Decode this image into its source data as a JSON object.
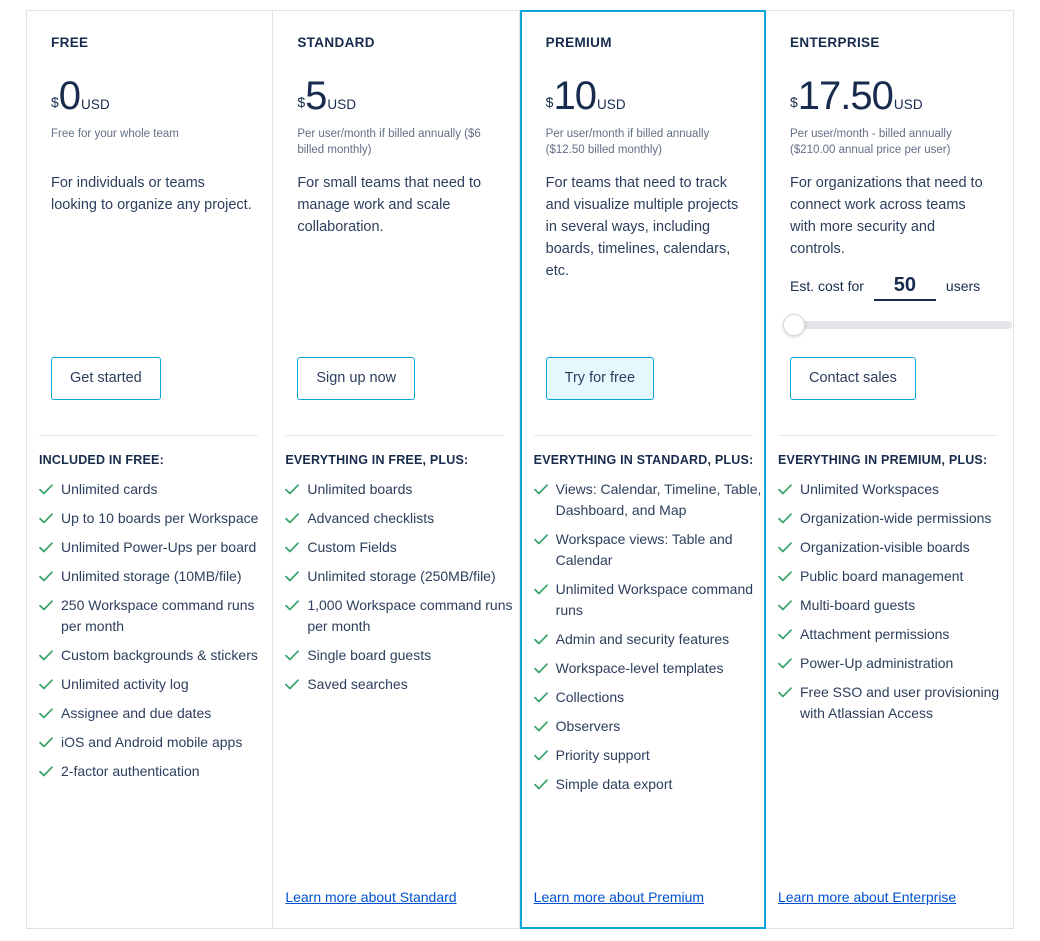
{
  "theme": {
    "accent": "#0ca5da",
    "accent_soft": "#e5f8fd",
    "text_primary": "#172b4d",
    "text_body": "#2c3e5d",
    "text_muted": "#626f86",
    "check_green": "#36a369",
    "link_blue": "#0052cc",
    "border_gray": "#dfe1e6"
  },
  "plans": [
    {
      "name": "FREE",
      "currency": "$",
      "amount": "0",
      "unit": "USD",
      "price_note": "Free for your whole team",
      "description": "For individuals or teams looking to organize any project.",
      "cta_label": "Get started",
      "cta_style": "outline",
      "features_title": "INCLUDED IN FREE:",
      "features": [
        "Unlimited cards",
        "Up to 10 boards per Workspace",
        "Unlimited Power-Ups per board",
        "Unlimited storage (10MB/file)",
        "250 Workspace command runs per month",
        "Custom backgrounds & stickers",
        "Unlimited activity log",
        "Assignee and due dates",
        "iOS and Android mobile apps",
        "2-factor authentication"
      ],
      "learn_more": null,
      "highlighted": false
    },
    {
      "name": "STANDARD",
      "currency": "$",
      "amount": "5",
      "unit": "USD",
      "price_note": "Per user/month if billed annually ($6 billed monthly)",
      "description": "For small teams that need to manage work and scale collaboration.",
      "cta_label": "Sign up now",
      "cta_style": "outline",
      "features_title": "EVERYTHING IN FREE, PLUS:",
      "features": [
        "Unlimited boards",
        "Advanced checklists",
        "Custom Fields",
        "Unlimited storage (250MB/file)",
        "1,000 Workspace command runs per month",
        "Single board guests",
        "Saved searches"
      ],
      "learn_more": "Learn more about Standard",
      "highlighted": false
    },
    {
      "name": "PREMIUM",
      "currency": "$",
      "amount": "10",
      "unit": "USD",
      "price_note": "Per user/month if billed annually ($12.50 billed monthly)",
      "description": "For teams that need to track and visualize multiple projects in several ways, including boards, timelines, calendars, etc.",
      "cta_label": "Try for free",
      "cta_style": "filled",
      "features_title": "EVERYTHING IN STANDARD, PLUS:",
      "features": [
        "Views: Calendar, Timeline, Table, Dashboard, and Map",
        "Workspace views: Table and Calendar",
        "Unlimited Workspace command runs",
        "Admin and security features",
        "Workspace-level templates",
        "Collections",
        "Observers",
        "Priority support",
        "Simple data export"
      ],
      "learn_more": "Learn more about Premium",
      "highlighted": true
    },
    {
      "name": "ENTERPRISE",
      "currency": "$",
      "amount": "17.50",
      "unit": "USD",
      "price_note": "Per user/month - billed annually ($210.00 annual price per user)",
      "description": "For organizations that need to connect work across teams with more security and controls.",
      "estimator": {
        "label_prefix": "Est. cost for",
        "value": "50",
        "label_suffix": "users",
        "slider_position_percent": 0
      },
      "cta_label": "Contact sales",
      "cta_style": "outline",
      "features_title": "EVERYTHING IN PREMIUM, PLUS:",
      "features": [
        "Unlimited Workspaces",
        "Organization-wide permissions",
        "Organization-visible boards",
        "Public board management",
        "Multi-board guests",
        "Attachment permissions",
        "Power-Up administration",
        "Free SSO and user provisioning with Atlassian Access"
      ],
      "learn_more": "Learn more about Enterprise",
      "highlighted": false
    }
  ]
}
